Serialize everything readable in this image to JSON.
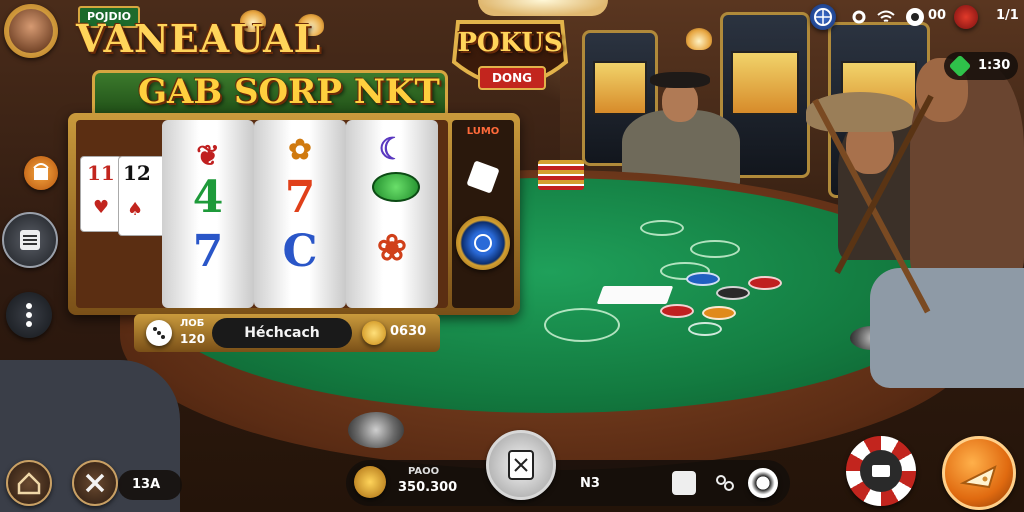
{
  "top_left": {
    "brand_small": "POJDIO",
    "title_line1": "VANEAUAL",
    "title_line2": "GAB SORP NKT"
  },
  "center_badge": {
    "line1": "POKUS",
    "line2": "DONG"
  },
  "status_bar": {
    "icon_count": "00",
    "right_label": "1/1",
    "gem_value": "1:30"
  },
  "slot": {
    "card1": "11",
    "card2": "12",
    "side_label": "LUMO",
    "reel_symbols": [
      "4",
      "7",
      "7",
      "C"
    ]
  },
  "bet_bar": {
    "left_label": "ЛОБ",
    "left_value": "120",
    "center_label": "Héchcach",
    "right_value": "0630"
  },
  "bottom_bar": {
    "counter_label": "13A",
    "balance_label": "PAOO",
    "balance_value": "350.300",
    "center_label": "N3"
  },
  "colors": {
    "felt": "#137b40",
    "gold": "#ffd45a",
    "accent_orange": "#f08a1c"
  }
}
